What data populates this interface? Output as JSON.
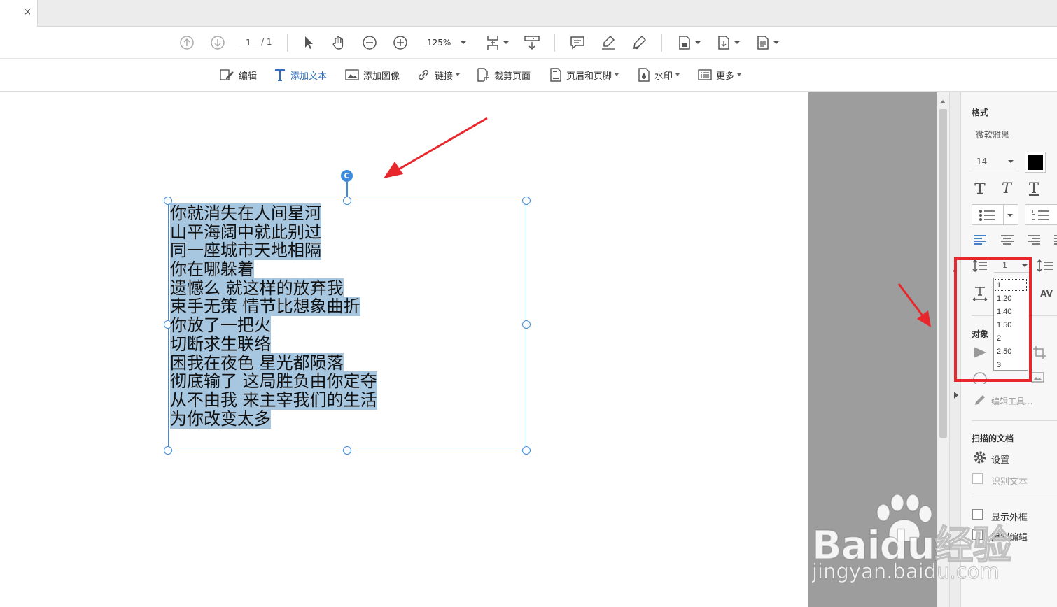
{
  "tab": {
    "close_label": "×"
  },
  "toolbar1": {
    "page_current": "1",
    "page_total": "/ 1",
    "zoom": "125%"
  },
  "toolbar2": {
    "edit": "编辑",
    "add_text": "添加文本",
    "add_image": "添加图像",
    "link": "链接",
    "crop": "裁剪页面",
    "header_footer": "页眉和页脚",
    "watermark": "水印",
    "more": "更多"
  },
  "document": {
    "rotate_glyph": "C",
    "lines": [
      "你就消失在人间星河",
      "山平海阔中就此别过",
      "同一座城市天地相隔",
      "你在哪躲着",
      "遗憾么 就这样的放弃我",
      "束手无策 情节比想象曲折",
      "你放了一把火",
      "切断求生联络",
      "困我在夜色 星光都陨落",
      "彻底输了 这局胜负由你定夺",
      "从不由我 来主宰我们的生活",
      "为你改变太多"
    ]
  },
  "panel": {
    "format_heading": "格式",
    "font_name": "微软雅黑",
    "font_size": "14",
    "line_spacing_value": "1",
    "line_spacing_options": [
      "1",
      "1.20",
      "1.40",
      "1.50",
      "2",
      "2.50",
      "3"
    ],
    "objects_heading": "对象",
    "edit_tools_label": "编辑工具...",
    "scanned_heading": "扫描的文档",
    "settings_label": "设置",
    "recognize_label": "识别文本",
    "show_border_label": "显示外框",
    "restrict_label": "限制编辑"
  },
  "watermark": {
    "brand": "Baidu经验",
    "url": "jingyan.baidu.com"
  },
  "colors": {
    "accent": "#2d6fbe",
    "selection": "#a7c6e0",
    "handle": "#3c8dde",
    "annotation_red": "#e8272c",
    "font_color_swatch": "#000000"
  }
}
